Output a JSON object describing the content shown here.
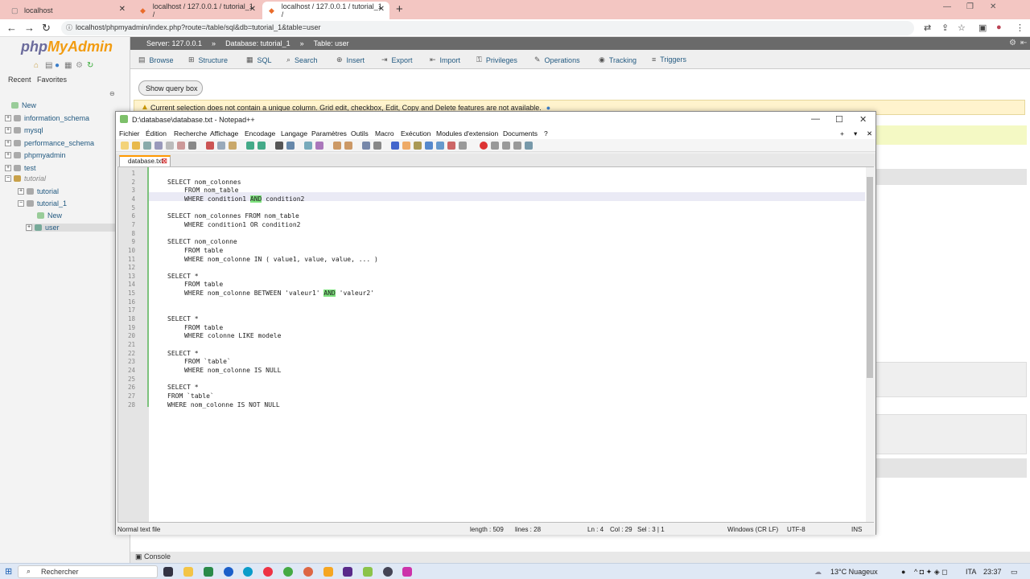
{
  "browser": {
    "tabs": [
      {
        "title": "localhost"
      },
      {
        "title": "localhost / 127.0.0.1 / tutorial_1 /"
      },
      {
        "title": "localhost / 127.0.0.1 / tutorial_1 /"
      }
    ],
    "url": "localhost/phpmyadmin/index.php?route=/table/sql&db=tutorial_1&table=user"
  },
  "pma": {
    "logo_a": "php",
    "logo_b": "MyAdmin",
    "recent": "Recent",
    "favorites": "Favorites",
    "tree": [
      "New",
      "information_schema",
      "mysql",
      "performance_schema",
      "phpmyadmin",
      "test",
      "tutorial",
      "tutorial",
      "tutorial_1",
      "New",
      "user"
    ],
    "breadcrumb": {
      "server": "Server: 127.0.0.1",
      "database": "Database: tutorial_1",
      "table": "Table: user"
    },
    "menu": [
      "Browse",
      "Structure",
      "SQL",
      "Search",
      "Insert",
      "Export",
      "Import",
      "Privileges",
      "Operations",
      "Tracking",
      "Triggers"
    ],
    "show_query": "Show query box",
    "warning": "Current selection does not contain a unique column. Grid edit, checkbox, Edit, Copy and Delete features are not available.",
    "console": "Console"
  },
  "npp": {
    "title": "D:\\database\\database.txt - Notepad++",
    "menu": [
      "Fichier",
      "Édition",
      "Recherche",
      "Affichage",
      "Encodage",
      "Langage",
      "Paramètres",
      "Outils",
      "Macro",
      "Exécution",
      "Modules d'extension",
      "Documents",
      "?"
    ],
    "tab": "database.txt",
    "lines": [
      {
        "n": "1",
        "t": "",
        "i": false
      },
      {
        "n": "2",
        "t": "SELECT nom_colonnes",
        "i": false
      },
      {
        "n": "3",
        "t": "FROM nom_table",
        "i": true
      },
      {
        "n": "4",
        "a": "WHERE condition1 ",
        "h": "AND",
        "b": " condition2",
        "i": true
      },
      {
        "n": "5",
        "t": "",
        "i": false
      },
      {
        "n": "6",
        "t": "SELECT nom_colonnes FROM nom_table",
        "i": false
      },
      {
        "n": "7",
        "t": "WHERE condition1 OR condition2",
        "i": true
      },
      {
        "n": "8",
        "t": "",
        "i": false
      },
      {
        "n": "9",
        "t": "SELECT nom_colonne",
        "i": false
      },
      {
        "n": "10",
        "t": "FROM table",
        "i": true
      },
      {
        "n": "11",
        "t": "WHERE nom_colonne IN ( value1, value, value, ... )",
        "i": true
      },
      {
        "n": "12",
        "t": "",
        "i": false
      },
      {
        "n": "13",
        "t": "SELECT *",
        "i": false
      },
      {
        "n": "14",
        "t": "FROM table",
        "i": true
      },
      {
        "n": "15",
        "a": "WHERE nom_colonne BETWEEN 'valeur1' ",
        "h": "AND",
        "b": " 'valeur2'",
        "i": true
      },
      {
        "n": "16",
        "t": "",
        "i": false
      },
      {
        "n": "17",
        "t": "",
        "i": false
      },
      {
        "n": "18",
        "t": "SELECT *",
        "i": false
      },
      {
        "n": "19",
        "t": "FROM table",
        "i": true
      },
      {
        "n": "20",
        "t": "WHERE colonne LIKE modele",
        "i": true
      },
      {
        "n": "21",
        "t": "",
        "i": false
      },
      {
        "n": "22",
        "t": "SELECT *",
        "i": false
      },
      {
        "n": "23",
        "t": "FROM `table`",
        "i": true
      },
      {
        "n": "24",
        "t": "WHERE nom_colonne IS NULL",
        "i": true
      },
      {
        "n": "25",
        "t": "",
        "i": false
      },
      {
        "n": "26",
        "t": "SELECT *",
        "i": false
      },
      {
        "n": "27",
        "t": "FROM `table`",
        "i": false
      },
      {
        "n": "28",
        "t": "WHERE nom_colonne IS NOT NULL",
        "i": false
      }
    ],
    "status": {
      "type": "Normal text file",
      "length": "length : 509",
      "lines": "lines : 28",
      "ln": "Ln : 4",
      "col": "Col : 29",
      "sel": "Sel : 3 | 1",
      "eol": "Windows (CR LF)",
      "enc": "UTF-8",
      "ins": "INS"
    }
  },
  "taskbar": {
    "search": "Rechercher",
    "weather": "13°C Nuageux",
    "lang": "ITA",
    "time": "23:37"
  }
}
